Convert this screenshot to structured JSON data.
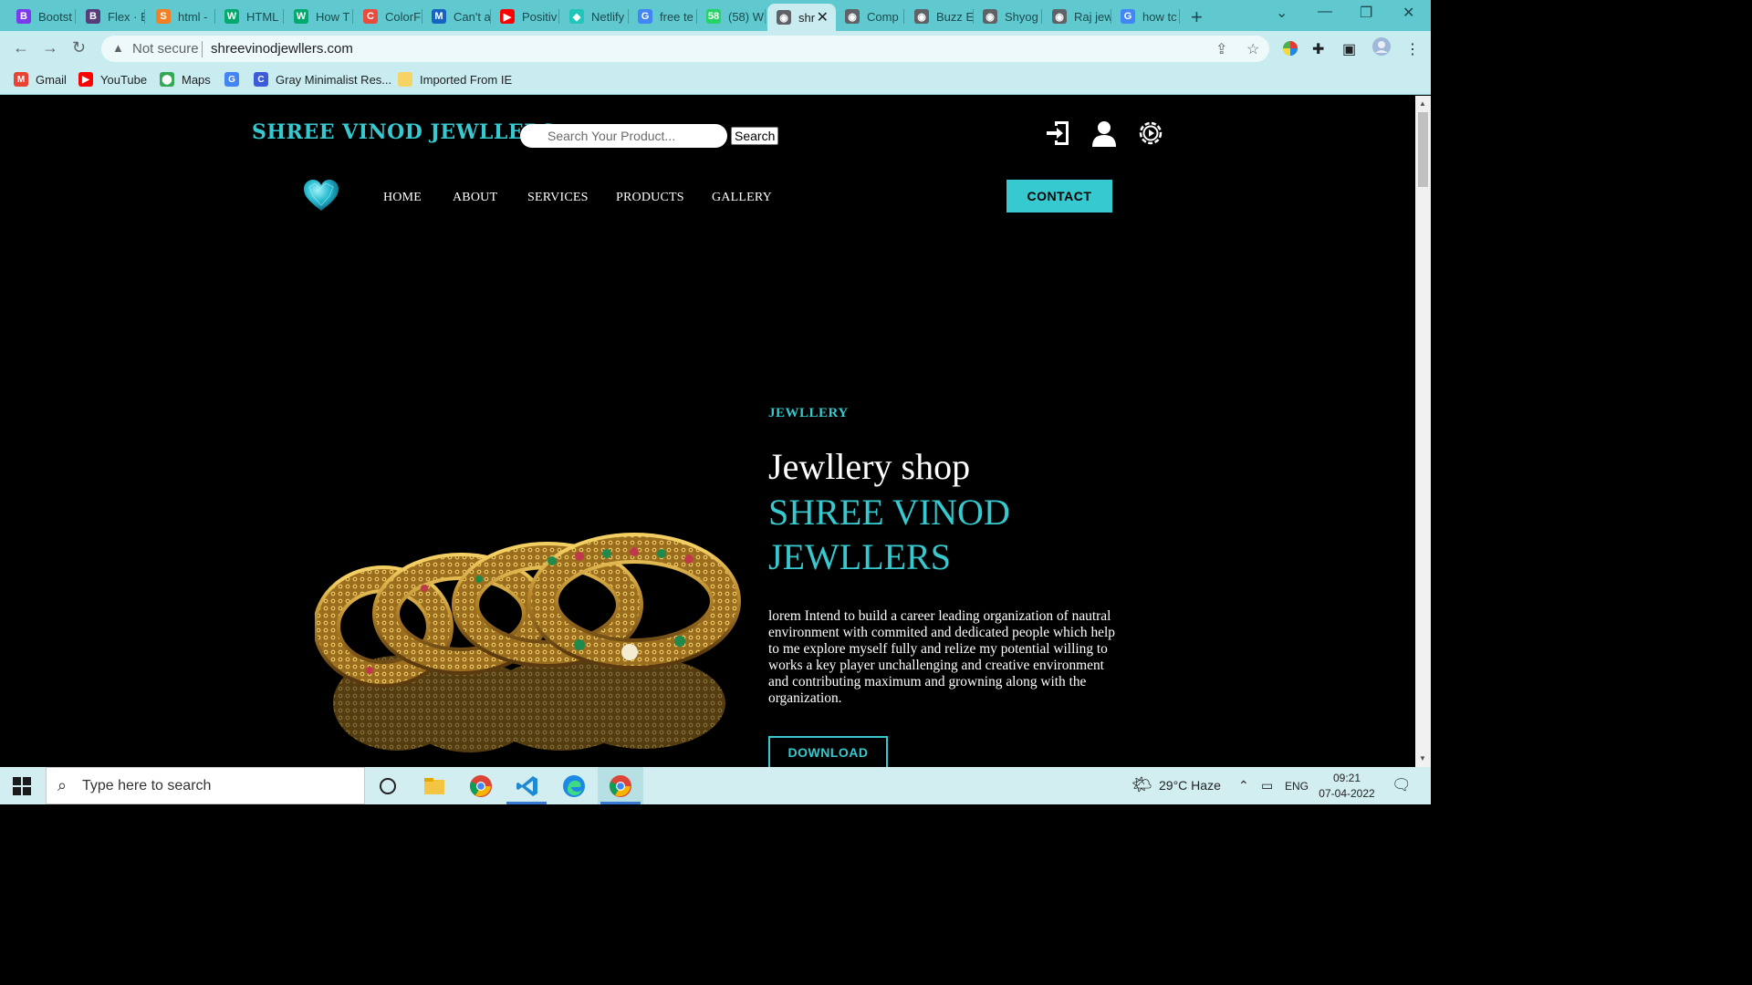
{
  "browser": {
    "tabs": [
      {
        "label": "Bootst",
        "favicon_color": "#7c3aed",
        "favicon": "B"
      },
      {
        "label": "Flex · E",
        "favicon_color": "#563d7c",
        "favicon": "B"
      },
      {
        "label": "html -",
        "favicon_color": "#f48024",
        "favicon": "S"
      },
      {
        "label": "HTML",
        "favicon_color": "#04aa6d",
        "favicon": "W"
      },
      {
        "label": "How T",
        "favicon_color": "#04aa6d",
        "favicon": "W"
      },
      {
        "label": "ColorF",
        "favicon_color": "#e94c3d",
        "favicon": "C"
      },
      {
        "label": "Can't a",
        "favicon_color": "#1565c0",
        "favicon": "M"
      },
      {
        "label": "Positiv",
        "favicon_color": "#ff0000",
        "favicon": "▶"
      },
      {
        "label": "Netlify",
        "favicon_color": "#20c6b7",
        "favicon": "◆"
      },
      {
        "label": "free te",
        "favicon_color": "#4285f4",
        "favicon": "G"
      },
      {
        "label": "(58) W",
        "favicon_color": "#25d366",
        "favicon": "58"
      },
      {
        "label": "shr",
        "favicon_color": "#5f6368",
        "favicon": "◉",
        "active": true
      },
      {
        "label": "Comp",
        "favicon_color": "#5f6368",
        "favicon": "◉"
      },
      {
        "label": "Buzz E",
        "favicon_color": "#5f6368",
        "favicon": "◉"
      },
      {
        "label": "Shyog",
        "favicon_color": "#5f6368",
        "favicon": "◉"
      },
      {
        "label": "Raj jew",
        "favicon_color": "#5f6368",
        "favicon": "◉"
      },
      {
        "label": "how tc",
        "favicon_color": "#4285f4",
        "favicon": "G"
      }
    ],
    "security_label": "Not secure",
    "url": "shreevinodjewllers.com",
    "bookmarks": [
      {
        "label": "Gmail",
        "color": "#ea4335",
        "glyph": "M"
      },
      {
        "label": "YouTube",
        "color": "#ff0000",
        "glyph": "▶"
      },
      {
        "label": "Maps",
        "color": "#34a853",
        "glyph": "⬤"
      },
      {
        "label": "",
        "color": "#4285f4",
        "glyph": "G"
      },
      {
        "label": "Gray Minimalist Res...",
        "color": "#3b5bdb",
        "glyph": "C"
      },
      {
        "label": "Imported From IE",
        "color": "#f6d365",
        "glyph": ""
      }
    ]
  },
  "site": {
    "logo": "SHREE VINOD JEWLLERS",
    "search_placeholder": "Search Your Product...",
    "search_button": "Search",
    "icons": [
      "login-icon",
      "user-icon",
      "settings-icon"
    ],
    "nav": [
      "HOME",
      "ABOUT",
      "SERVICES",
      "PRODUCTS",
      "GALLERY"
    ],
    "contact_button": "CONTACT",
    "hero": {
      "eyebrow": "JEWLLERY",
      "title": "Jewllery shop",
      "subtitle": "SHREE VINOD JEWLLERS",
      "body": "lorem Intend to build a career leading organization of nautral environment with commited and dedicated people which help to me explore myself fully and relize my potential willing to works a key player unchallenging and creative environment and contributing maximum and growning along with the organization.",
      "button": "DOWNLOAD"
    },
    "accent_color": "#36c9cf"
  },
  "taskbar": {
    "search_placeholder": "Type here to search",
    "weather": "29°C  Haze",
    "language": "ENG",
    "time": "09:21",
    "date": "07-04-2022"
  }
}
